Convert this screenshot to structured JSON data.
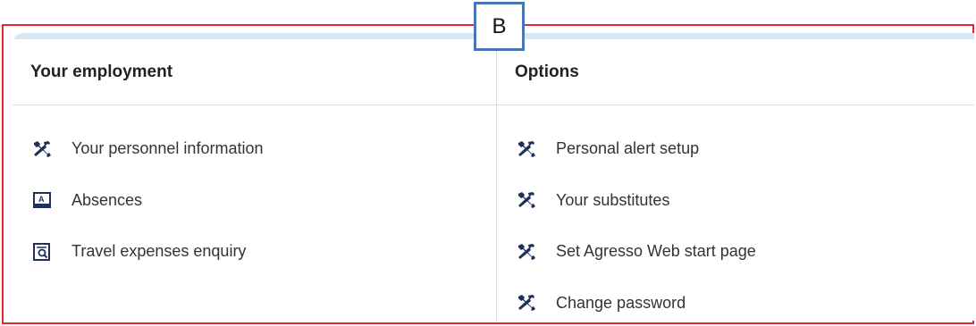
{
  "callout": {
    "label": "B"
  },
  "employment": {
    "title": "Your employment",
    "items": [
      {
        "label": "Your personnel information",
        "icon": "tools-icon"
      },
      {
        "label": "Absences",
        "icon": "calendar-a-icon"
      },
      {
        "label": "Travel expenses enquiry",
        "icon": "document-search-icon"
      }
    ]
  },
  "options": {
    "title": "Options",
    "items": [
      {
        "label": "Personal alert setup",
        "icon": "tools-icon"
      },
      {
        "label": "Your substitutes",
        "icon": "tools-icon"
      },
      {
        "label": "Set Agresso Web start page",
        "icon": "tools-icon"
      },
      {
        "label": "Change password",
        "icon": "tools-icon"
      }
    ]
  },
  "colors": {
    "frame_border": "#e4262d",
    "callout_border": "#4a76b5",
    "panel_band": "#d7e8f6",
    "icon": "#1e2f5a"
  }
}
